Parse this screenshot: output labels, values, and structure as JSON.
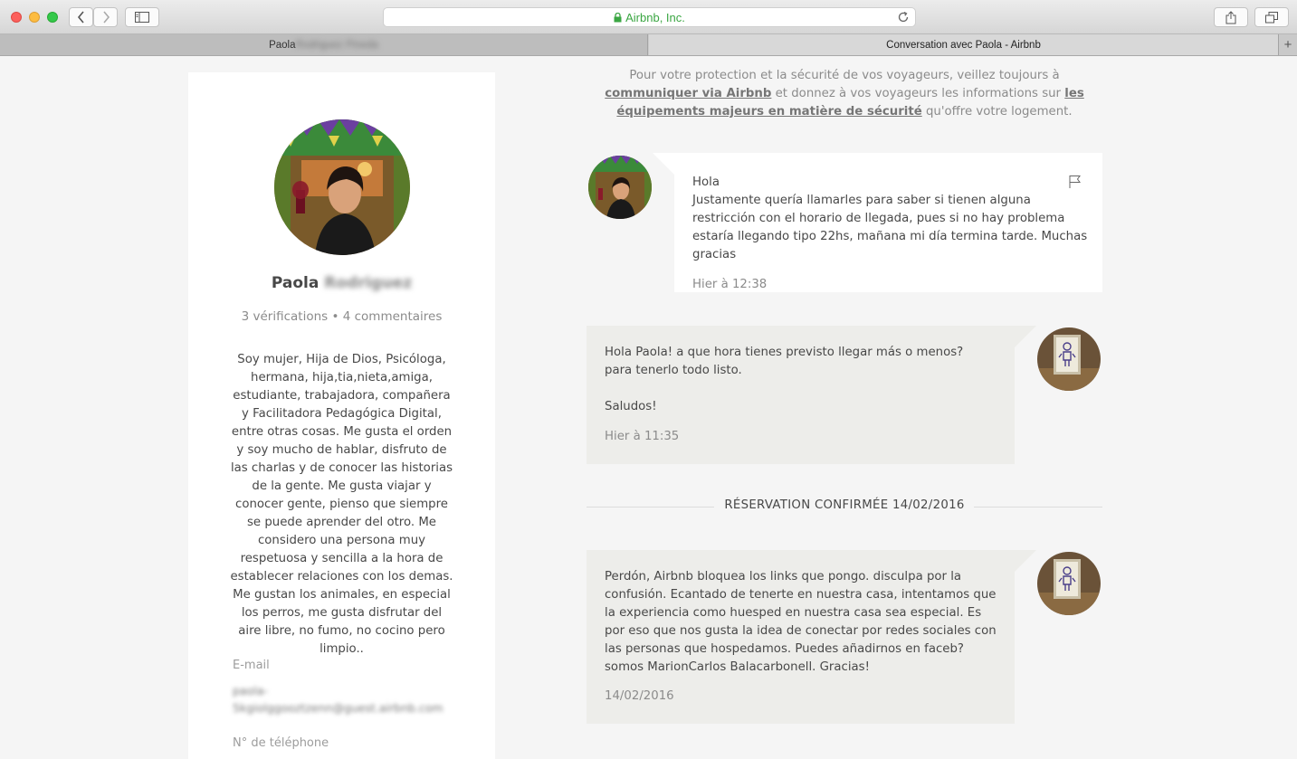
{
  "browser": {
    "address": "Airbnb, Inc.",
    "tabs": [
      {
        "label_visible": "Paola",
        "label_blurred": "Rodriguez Pineda"
      },
      {
        "label": "Conversation avec Paola - Airbnb"
      }
    ],
    "colors": {
      "secure": "#3aa642"
    }
  },
  "profile": {
    "first_name": "Paola",
    "last_name_blurred": "Rodriguez",
    "meta": "3 vérifications • 4 commentaires",
    "bio": "Soy mujer, Hija de Dios, Psicóloga, hermana, hija,tia,nieta,amiga, estudiante, trabajadora, compañera y Facilitadora Pedagógica Digital, entre otras cosas. Me gusta el orden y soy mucho de hablar, disfruto de las charlas y de conocer las historias de la gente. Me gusta viajar y conocer gente, pienso que siempre se puede aprender del otro. Me considero una persona muy respetuosa y sencilla a la hora de establecer relaciones con los demas. Me gustan los animales, en especial los perros, me gusta disfrutar del aire libre, no fumo, no cocino pero limpio..",
    "email_label": "E-mail",
    "email_blurred": "paola-5kgiolggooztzenn@guest.airbnb.com",
    "phone_label": "N° de téléphone"
  },
  "notice": {
    "part1": "Pour votre protection et la sécurité de vos voyageurs, veillez toujours à ",
    "link1": "communiquer via Airbnb",
    "part2": " et donnez à vos voyageurs les informations sur ",
    "link2": "les équipements majeurs en matière de sécurité",
    "part3": " qu'offre votre logement."
  },
  "messages": [
    {
      "from": "guest",
      "line1": "Hola",
      "line2": "Justamente quería llamarles para saber si tienen alguna restricción con el horario de llegada, pues si no hay problema estaría llegando tipo 22hs, mañana mi día termina tarde. Muchas gracias",
      "time": "Hier à 12:38"
    },
    {
      "from": "host",
      "line1": "Hola Paola! a que hora tienes previsto llegar más o menos? para tenerlo todo listo.",
      "line2": "Saludos!",
      "time": "Hier à 11:35"
    },
    {
      "from": "host",
      "line1": "Perdón, Airbnb bloquea los links que pongo. disculpa por la confusión.  Ecantado de tenerte en nuestra casa, intentamos que la experiencia como huesped en nuestra casa sea especial. Es por eso que nos gusta la idea de conectar por redes sociales con las personas que hospedamos. Puedes añadirnos en faceb? somos MarionCarlos Balacarbonell. Gracias!",
      "time": "14/02/2016"
    }
  ],
  "divider": "RÉSERVATION CONFIRMÉE 14/02/2016"
}
